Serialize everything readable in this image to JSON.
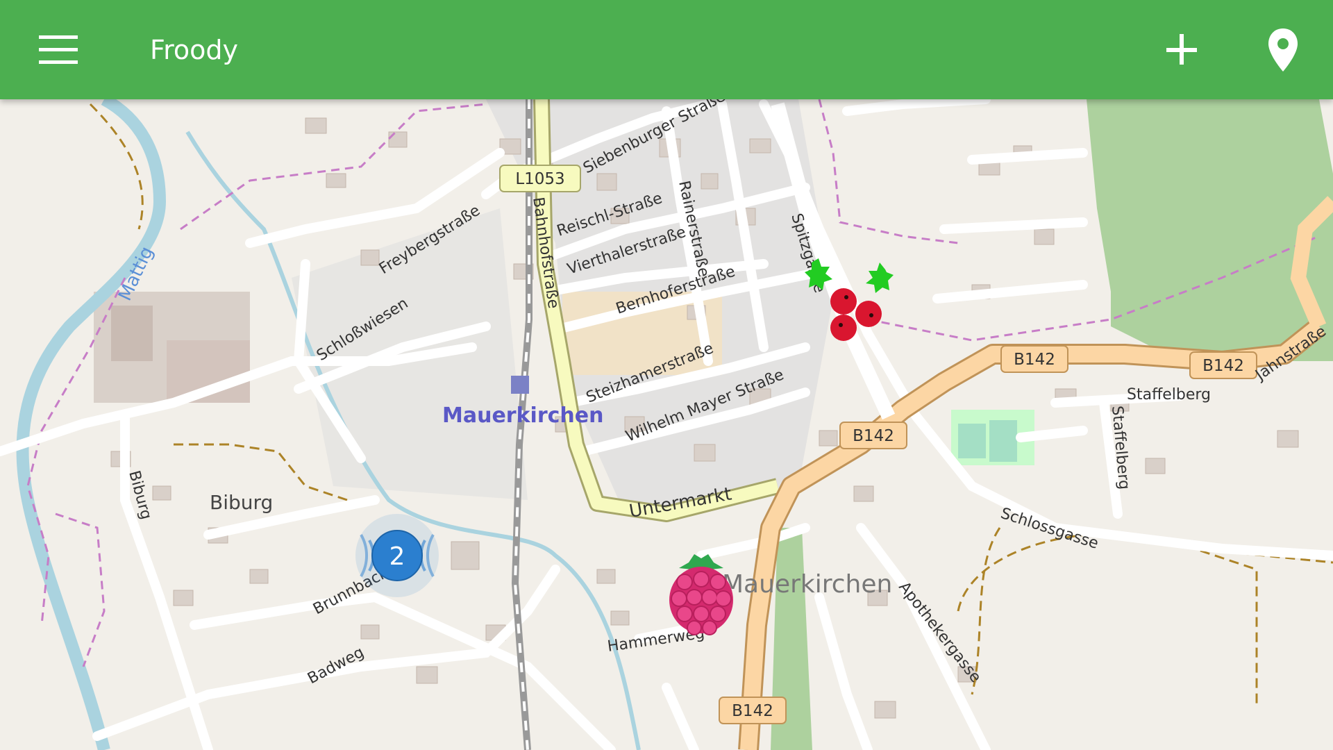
{
  "app": {
    "title": "Froody",
    "accent_color": "#4caf50"
  },
  "toolbar": {
    "menu_icon": "hamburger-menu-icon",
    "add_icon": "plus-icon",
    "location_icon": "location-pin-icon"
  },
  "map": {
    "town_label": "Mauerkirchen",
    "place_label_biburg": "Biburg",
    "place_label_mauerkirchen": "Mauerkirchen",
    "river_label": "Mattig",
    "road_shields": [
      "L1053",
      "B142",
      "B142",
      "B142",
      "B142"
    ],
    "street_labels": {
      "siebenburger": "Siebenburger Straße",
      "reischl": "Reischl-Straße",
      "rainer": "Rainerstraße",
      "vierthaler": "Vierthalerstraße",
      "bernhofer": "Bernhoferstraße",
      "bahnhof": "Bahnhofstraße",
      "freyberg": "Freybergstraße",
      "schlosswiesen": "Schloßwiesen",
      "steizhamer": "Steizhamerstraße",
      "wilhelm_mayer": "Wilhelm Mayer Straße",
      "untermarkt": "Untermarkt",
      "spitzgasse": "Spitzgasse",
      "jahnstrasse": "Jahnstraße",
      "staffelberg_h": "Staffelberg",
      "staffelberg_v": "Staffelberg",
      "schlossgasse": "Schlossgasse",
      "apothekergasse": "Apothekergasse",
      "biburg_street": "Biburg",
      "brunnbach": "Brunnbach",
      "badweg": "Badweg",
      "hammerweg": "Hammerweg"
    },
    "markers": [
      {
        "type": "cluster",
        "count": "2",
        "color": "#2b7fcf"
      },
      {
        "type": "holly-berries",
        "icon": "holly-berry-icon"
      },
      {
        "type": "raspberry",
        "icon": "raspberry-icon"
      }
    ]
  }
}
